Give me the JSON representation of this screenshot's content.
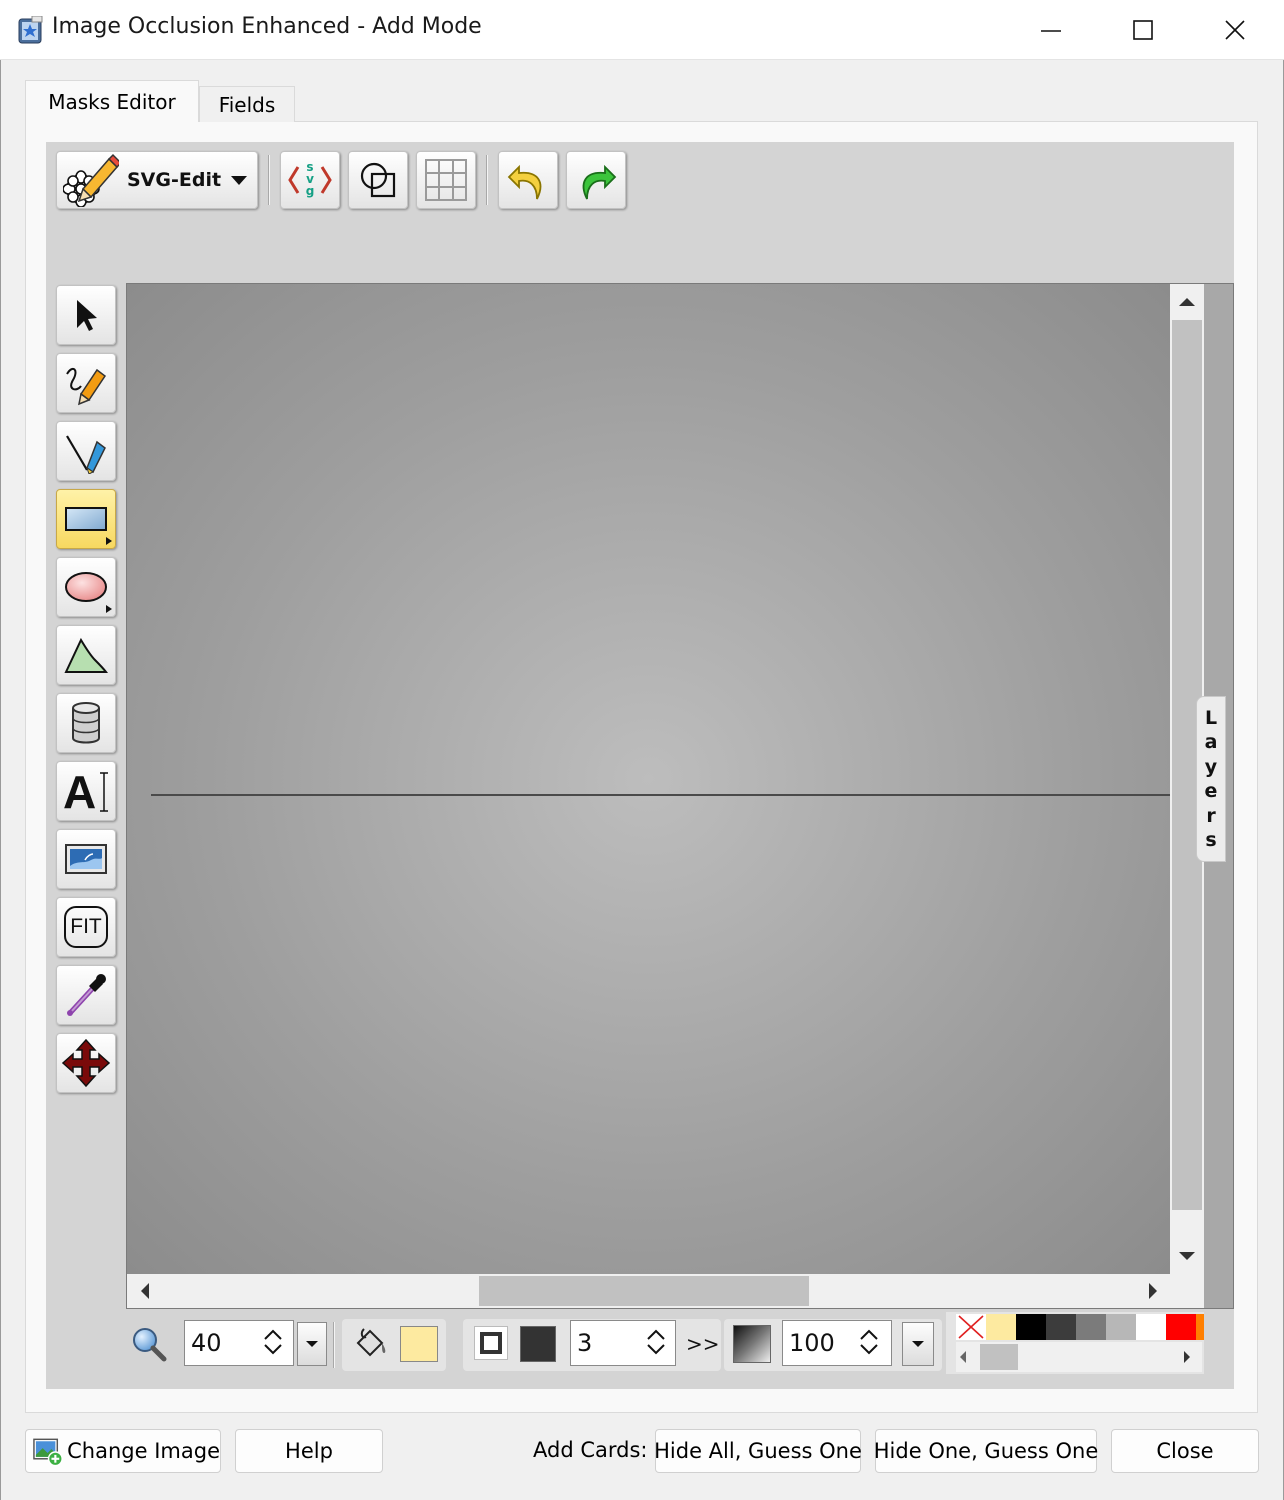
{
  "window": {
    "title": "Image Occlusion Enhanced - Add Mode",
    "controls": [
      "minimize-icon",
      "maximize-icon",
      "close-icon"
    ]
  },
  "tabs": [
    {
      "label": "Masks Editor",
      "selected": true
    },
    {
      "label": "Fields",
      "selected": false
    }
  ],
  "toolbar": {
    "menu_label": "SVG-Edit",
    "buttons": [
      "svg-source-icon",
      "wireframe-icon",
      "grid-icon",
      "undo-icon",
      "redo-icon"
    ]
  },
  "tools": [
    {
      "name": "select-tool",
      "icon": "pointer-arrow-icon",
      "selected": false
    },
    {
      "name": "pencil-tool",
      "icon": "freehand-pencil-icon",
      "selected": false
    },
    {
      "name": "line-tool",
      "icon": "line-pen-icon",
      "selected": false
    },
    {
      "name": "rectangle-tool",
      "icon": "rectangle-icon",
      "selected": true
    },
    {
      "name": "ellipse-tool",
      "icon": "ellipse-icon",
      "selected": false
    },
    {
      "name": "path-tool",
      "icon": "path-icon",
      "selected": false
    },
    {
      "name": "shape-library-tool",
      "icon": "cylinder-icon",
      "selected": false
    },
    {
      "name": "text-tool",
      "icon": "text-icon",
      "selected": false
    },
    {
      "name": "image-tool",
      "icon": "image-icon",
      "selected": false
    },
    {
      "name": "fit-tool",
      "icon": "fit-icon",
      "selected": false
    },
    {
      "name": "eyedropper-tool",
      "icon": "eyedropper-icon",
      "selected": false
    },
    {
      "name": "pan-tool",
      "icon": "move-arrows-icon",
      "selected": false
    }
  ],
  "fit_label": "FIT",
  "text_tool_label": "A",
  "layers_label": [
    "L",
    "a",
    "y",
    "e",
    "r",
    "s"
  ],
  "bottom": {
    "zoom_value": "40",
    "stroke_width": "3",
    "more_label": ">>",
    "opacity_value": "100",
    "fill_color": "#fdeaa0",
    "stroke_color": "#333333",
    "palette": [
      "none",
      "#fdeaa0",
      "#000000",
      "#3c3c3c",
      "#7b7b7b",
      "#b7b7b7",
      "#ffffff",
      "#ff0000",
      "#ff7f00"
    ]
  },
  "footer": {
    "change_image": "Change Image",
    "help": "Help",
    "add_cards_label": "Add Cards:",
    "hide_all": "Hide All, Guess One",
    "hide_one": "Hide One, Guess One",
    "close": "Close"
  }
}
